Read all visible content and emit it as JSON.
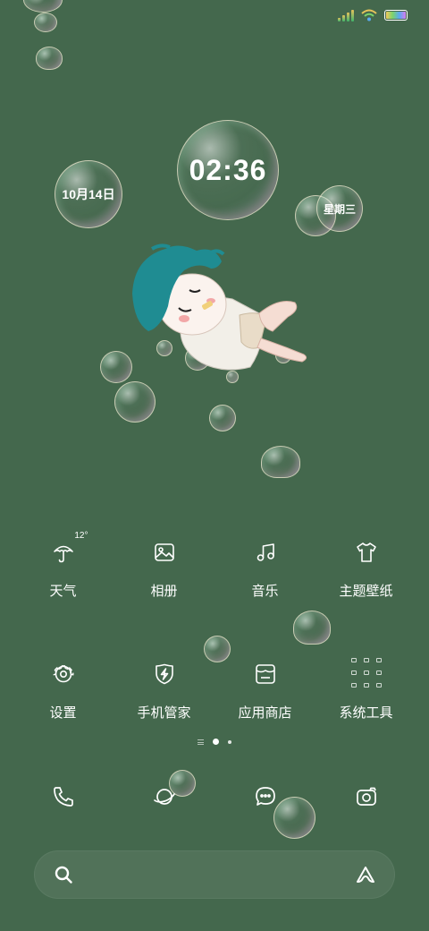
{
  "clock": {
    "time": "02:36",
    "date": "10月14日",
    "weekday": "星期三"
  },
  "weather": {
    "temp": "12°"
  },
  "apps": [
    {
      "label": "天气",
      "icon": "umbrella-icon"
    },
    {
      "label": "相册",
      "icon": "gallery-icon"
    },
    {
      "label": "音乐",
      "icon": "music-note-icon"
    },
    {
      "label": "主题壁纸",
      "icon": "tshirt-icon"
    },
    {
      "label": "设置",
      "icon": "gear-icon"
    },
    {
      "label": "手机管家",
      "icon": "shield-bolt-icon"
    },
    {
      "label": "应用商店",
      "icon": "store-icon"
    },
    {
      "label": "系统工具",
      "icon": "folder-grid-icon"
    }
  ],
  "dock": [
    {
      "icon": "phone-icon"
    },
    {
      "icon": "planet-browser-icon"
    },
    {
      "icon": "message-bubble-icon"
    },
    {
      "icon": "camera-icon"
    }
  ],
  "search": {
    "left_icon": "search-icon",
    "right_icon": "assistant-logo-icon"
  },
  "pager": {
    "pages": 2,
    "current": 1
  },
  "colors": {
    "background": "#44684d",
    "foreground": "#ffffff"
  }
}
